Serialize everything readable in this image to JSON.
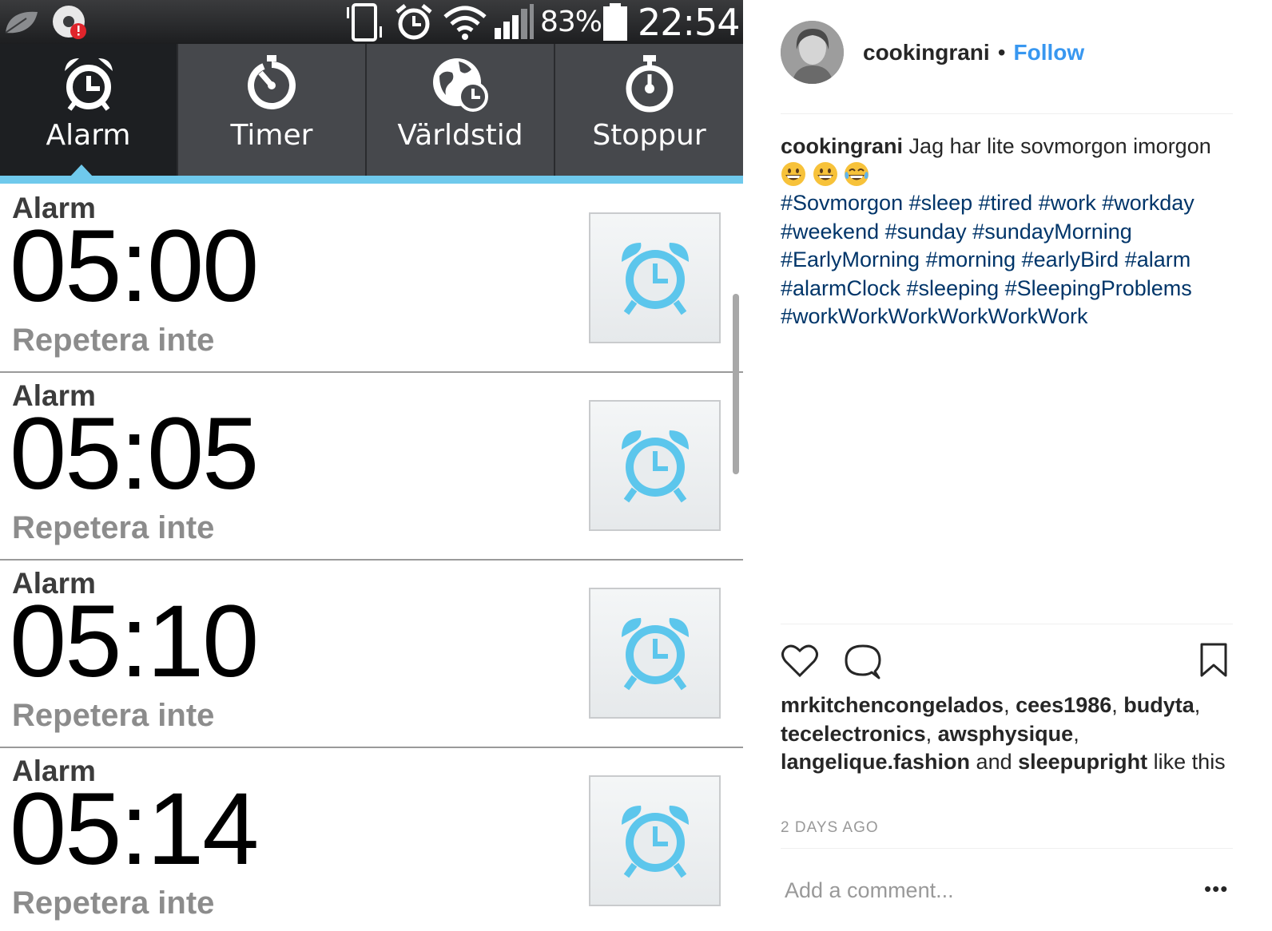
{
  "phone": {
    "status_bar": {
      "battery_percent": "83%",
      "time": "22:54",
      "icons": [
        "leaf-icon",
        "notification-icon",
        "vibrate-icon",
        "alarm-status-icon",
        "wifi-icon",
        "signal-icon",
        "battery-icon"
      ]
    },
    "tabs": [
      {
        "label": "Alarm",
        "icon": "alarm-clock-icon",
        "selected": true
      },
      {
        "label": "Timer",
        "icon": "timer-icon",
        "selected": false
      },
      {
        "label": "Världstid",
        "icon": "world-clock-icon",
        "selected": false
      },
      {
        "label": "Stoppur",
        "icon": "stopwatch-icon",
        "selected": false
      }
    ],
    "alarms": [
      {
        "name": "Alarm",
        "time": "05:00",
        "repeat": "Repetera inte"
      },
      {
        "name": "Alarm",
        "time": "05:05",
        "repeat": "Repetera inte"
      },
      {
        "name": "Alarm",
        "time": "05:10",
        "repeat": "Repetera inte"
      },
      {
        "name": "Alarm",
        "time": "05:14",
        "repeat": "Repetera inte"
      }
    ],
    "accent_color": "#6fc9ec"
  },
  "instagram": {
    "username": "cookingrani",
    "separator": "•",
    "follow_label": "Follow",
    "caption": {
      "user": "cookingrani",
      "text": "Jag har lite sovmorgon imorgon",
      "emojis": [
        "grinning-face",
        "grinning-face",
        "tears-of-joy-face"
      ],
      "hashtags": "#Sovmorgon #sleep #tired #work #workday #weekend #sunday #sundayMorning #EarlyMorning #morning #earlyBird #alarm #alarmClock #sleeping #SleepingProblems #workWorkWorkWorkWorkWork"
    },
    "likes": {
      "users": [
        "mrkitchencongelados",
        "cees1986",
        "budyta",
        "tecelectronics",
        "awsphysique",
        "langelique.fashion"
      ],
      "last_user": "sleepupright",
      "comma": ",",
      "and_text": "and",
      "suffix": "like this"
    },
    "date": "2 DAYS AGO",
    "comment_placeholder": "Add a comment...",
    "more_label": "•••",
    "link_color": "#3897f0",
    "hashtag_color": "#003569"
  }
}
